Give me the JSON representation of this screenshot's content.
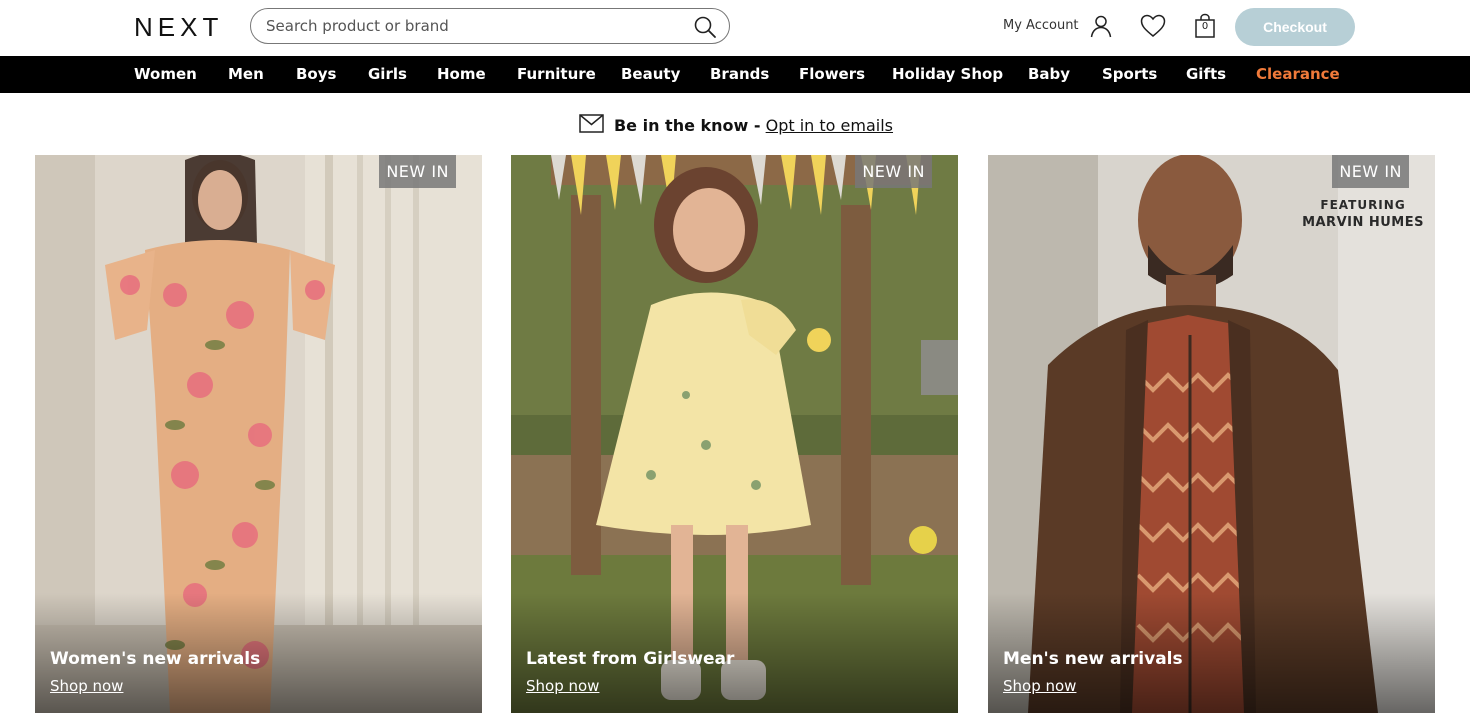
{
  "header": {
    "logo": "NEXT",
    "search_placeholder": "Search product or brand",
    "account_label": "My Account",
    "bag_count": "0",
    "checkout_label": "Checkout"
  },
  "nav": {
    "items": [
      {
        "label": "Women"
      },
      {
        "label": "Men"
      },
      {
        "label": "Boys"
      },
      {
        "label": "Girls"
      },
      {
        "label": "Home"
      },
      {
        "label": "Furniture"
      },
      {
        "label": "Beauty"
      },
      {
        "label": "Brands"
      },
      {
        "label": "Flowers"
      },
      {
        "label": "Holiday Shop"
      },
      {
        "label": "Baby"
      },
      {
        "label": "Sports"
      },
      {
        "label": "Gifts"
      },
      {
        "label": "Clearance"
      }
    ],
    "clearance_color": "#f07a3a"
  },
  "promo": {
    "text": "Be in the know -",
    "link": "Opt in to emails"
  },
  "tiles": [
    {
      "badge": "NEW IN",
      "title": "Women's new arrivals",
      "link": "Shop now"
    },
    {
      "badge": "NEW IN",
      "title": "Latest from Girlswear",
      "link": "Shop now"
    },
    {
      "badge": "NEW IN",
      "title": "Men's new arrivals",
      "link": "Shop now",
      "featuring_line1": "FEATURING",
      "featuring_line2": "MARVIN HUMES"
    }
  ],
  "colors": {
    "nav_bg": "#000000",
    "checkout_bg": "#b7cfd6"
  }
}
